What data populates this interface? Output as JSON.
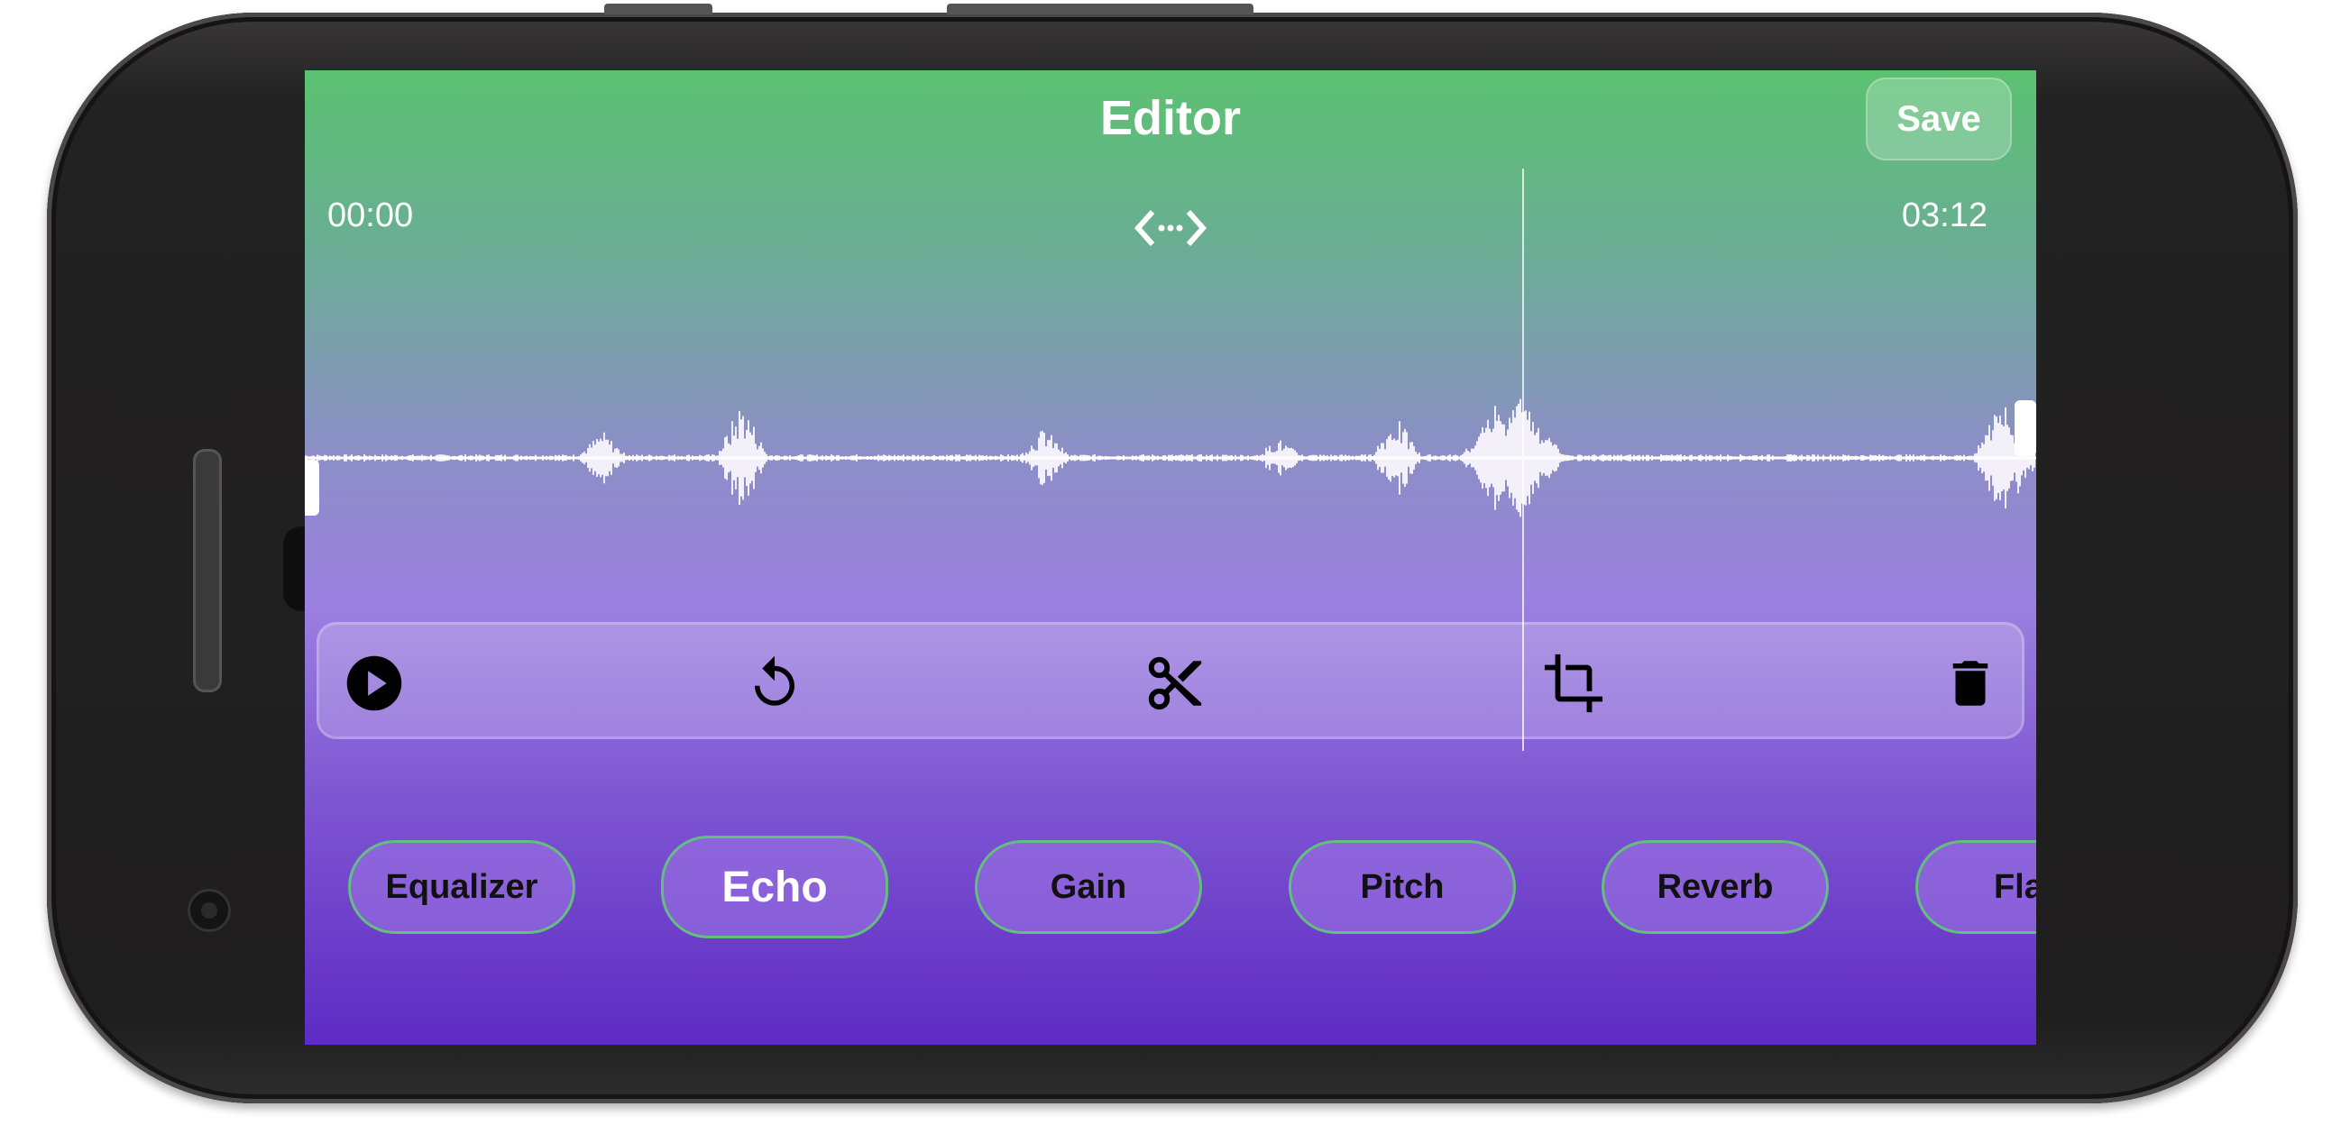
{
  "header": {
    "title": "Editor",
    "save_label": "Save"
  },
  "timeline": {
    "start_time": "00:00",
    "end_time": "03:12",
    "expand_icon": "code-expand-icon"
  },
  "toolbar": {
    "tools": [
      {
        "name": "play",
        "icon": "play-circle-icon"
      },
      {
        "name": "undo",
        "icon": "undo-icon"
      },
      {
        "name": "cut",
        "icon": "scissors-icon"
      },
      {
        "name": "crop",
        "icon": "crop-icon"
      },
      {
        "name": "delete",
        "icon": "trash-icon"
      }
    ]
  },
  "effects": {
    "items": [
      {
        "label": "Equalizer",
        "active": false
      },
      {
        "label": "Echo",
        "active": true
      },
      {
        "label": "Gain",
        "active": false
      },
      {
        "label": "Pitch",
        "active": false
      },
      {
        "label": "Reverb",
        "active": false
      },
      {
        "label": "Flan",
        "active": false
      }
    ]
  },
  "colors": {
    "gradient_top": "#5bc271",
    "gradient_mid": "#9b7fe0",
    "gradient_bottom": "#5e2bc4",
    "chip_border": "#62bf7d"
  }
}
